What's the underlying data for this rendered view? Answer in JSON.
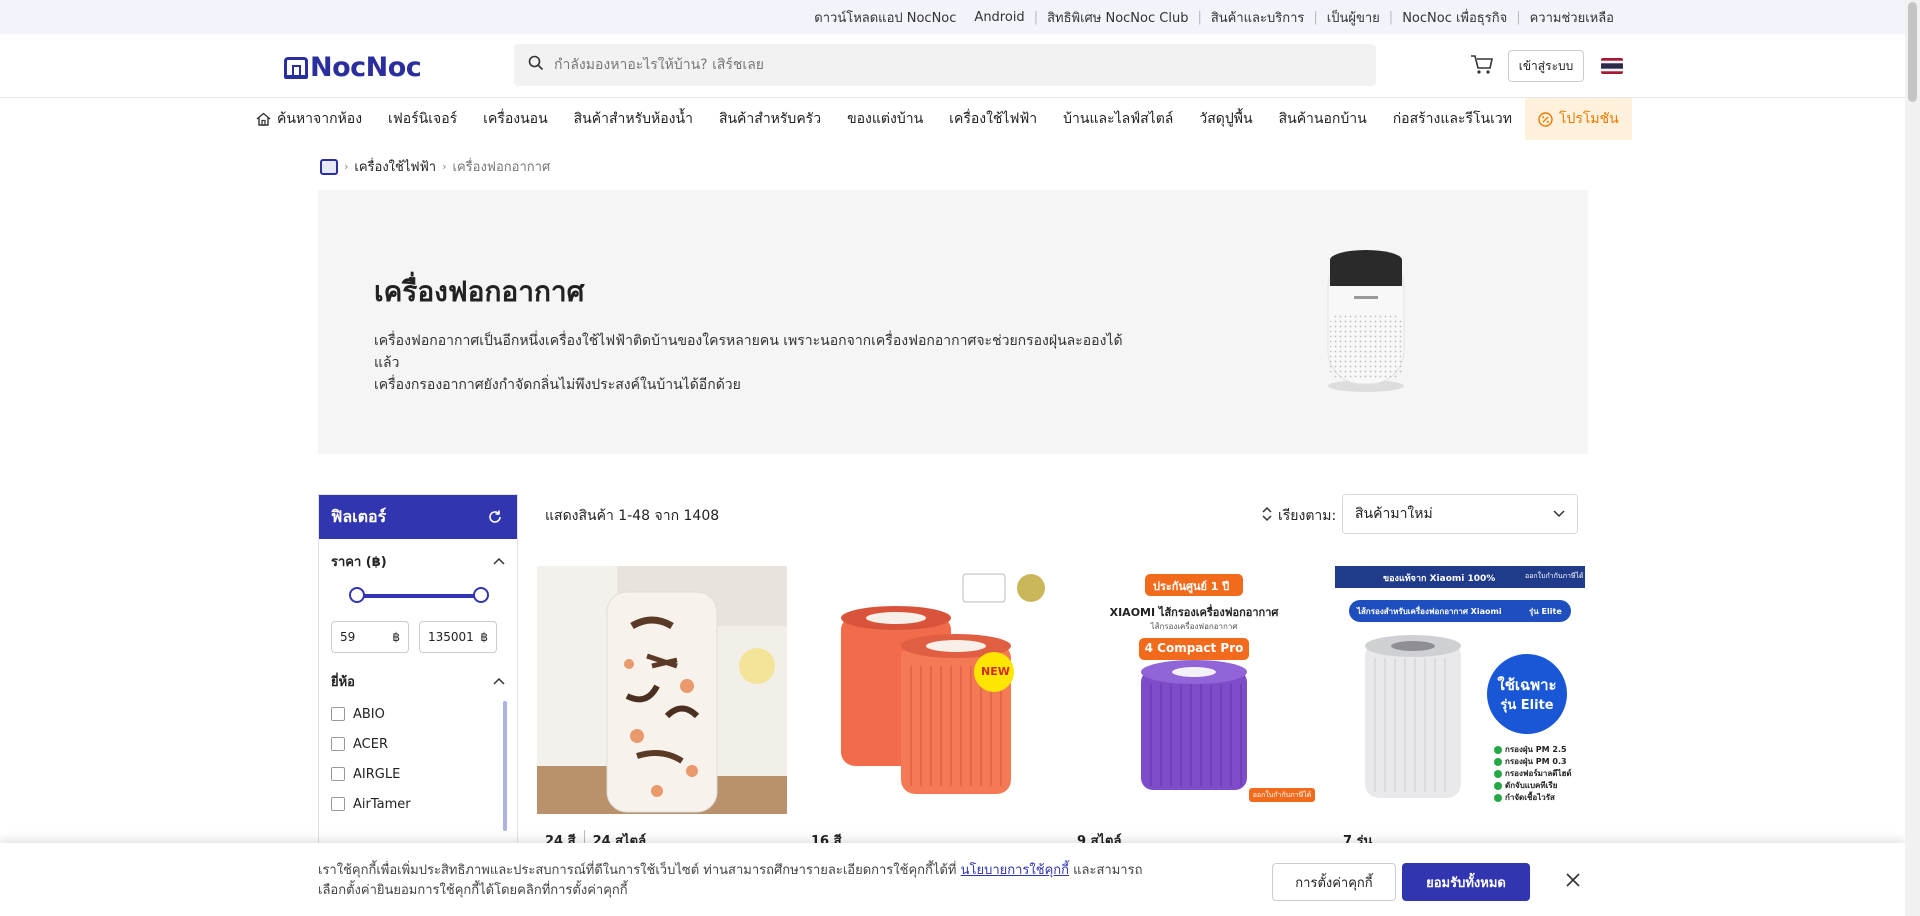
{
  "top_links": [
    {
      "label": "ดาวน์โหลดแอป NocNoc"
    },
    {
      "label": "Android"
    },
    {
      "label": "สิทธิพิเศษ NocNoc Club"
    },
    {
      "label": "สินค้าและบริการ"
    },
    {
      "label": "เป็นผู้ขาย"
    },
    {
      "label": "NocNoc เพื่อธุรกิจ"
    },
    {
      "label": "ความช่วยเหลือ"
    }
  ],
  "header": {
    "logo_text": "NocNoc",
    "search_placeholder": "กำลังมองหาอะไรให้บ้าน? เสิร์ชเลย",
    "login_label": "เข้าสู่ระบบ"
  },
  "nav": {
    "items": [
      {
        "label": "ค้นหาจากห้อง"
      },
      {
        "label": "เฟอร์นิเจอร์"
      },
      {
        "label": "เครื่องนอน"
      },
      {
        "label": "สินค้าสำหรับห้องน้ำ"
      },
      {
        "label": "สินค้าสำหรับครัว"
      },
      {
        "label": "ของแต่งบ้าน"
      },
      {
        "label": "เครื่องใช้ไฟฟ้า"
      },
      {
        "label": "บ้านและไลฟ์สไตล์"
      },
      {
        "label": "วัสดุปูพื้น"
      },
      {
        "label": "สินค้านอกบ้าน"
      },
      {
        "label": "ก่อสร้างและรีโนเวท"
      },
      {
        "label": "โปรโมชัน"
      }
    ]
  },
  "breadcrumb": {
    "items": [
      "เครื่องใช้ไฟฟ้า",
      "เครื่องฟอกอากาศ"
    ]
  },
  "hero": {
    "title": "เครื่องฟอกอากาศ",
    "description_line1": "เครื่องฟอกอากาศเป็นอีกหนึ่งเครื่องใช้ไฟฟ้าติดบ้านของใครหลายคน เพราะนอกจากเครื่องฟอกอากาศจะช่วยกรองฝุ่นละอองได้แล้ว",
    "description_line2": "เครื่องกรองอากาศยังกำจัดกลิ่นไม่พึงประสงค์ในบ้านได้อีกด้วย"
  },
  "filter": {
    "title": "ฟิลเตอร์",
    "price_title": "ราคา (฿)",
    "price_min": "59",
    "price_max": "135001",
    "currency": "฿",
    "brand_title": "ยี่ห้อ",
    "brands": [
      "ABIO",
      "ACER",
      "AIRGLE",
      "AirTamer"
    ]
  },
  "results": {
    "count_text": "แสดงสินค้า 1-48 จาก 1408",
    "sort_label": "เรียงตาม:",
    "sort_value": "สินค้ามาใหม่"
  },
  "products": [
    {
      "variants": [
        "24 สี",
        "24 สไตล์"
      ]
    },
    {
      "variants": [
        "16 สี"
      ],
      "badge": "NEW"
    },
    {
      "variants": [
        "9 สไตล์"
      ],
      "top_label": "ประกันศูนย์ 1 ปี",
      "heading": "XIAOMI ไส้กรองเครื่องฟอกอากาศ",
      "subheading": "ไส้กรองเครื่องฟอกอากาศ",
      "model": "4 Compact Pro",
      "footnote": "ออกใบกำกับภาษีได้"
    },
    {
      "variants": [
        "7 รุ่น"
      ],
      "top_label": "ของแท้จาก Xiaomi 100%",
      "top_right": "ออกใบกำกับภาษีได้",
      "heading": "ไส้กรองสำหรับเครื่องฟอกอากาศ Xiaomi",
      "model": "รุ่น Elite",
      "circle_text_1": "ใช้เฉพาะ",
      "circle_text_2": "รุ่น Elite",
      "features": [
        "กรองฝุ่น PM 2.5",
        "กรองฝุ่น PM 0.3",
        "กรองฟอร์มาลดีไฮด์",
        "ดักจับแบคทีเรีย",
        "กำจัดเชื้อไวรัส"
      ]
    }
  ],
  "cookie": {
    "text_before_link": "เราใช้คุกกี้เพื่อเพิ่มประสิทธิภาพและประสบการณ์ที่ดีในการใช้เว็บไซต์ ท่านสามารถศึกษารายละเอียดการใช้คุกกี้ได้ที่",
    "link": "นโยบายการใช้คุกกี้",
    "text_after_link": "และสามารถเลือกตั้งค่ายินยอมการใช้คุกกี้ได้โดยคลิกที่การตั้งค่าคุกกี้",
    "settings_label": "การตั้งค่าคุกกี้",
    "accept_label": "ยอมรับทั้งหมด"
  },
  "colors": {
    "brand": "#2b2f9e",
    "filter_header": "#3135b0",
    "promo_bg": "#fff1dc",
    "promo_text": "#f07a00"
  }
}
